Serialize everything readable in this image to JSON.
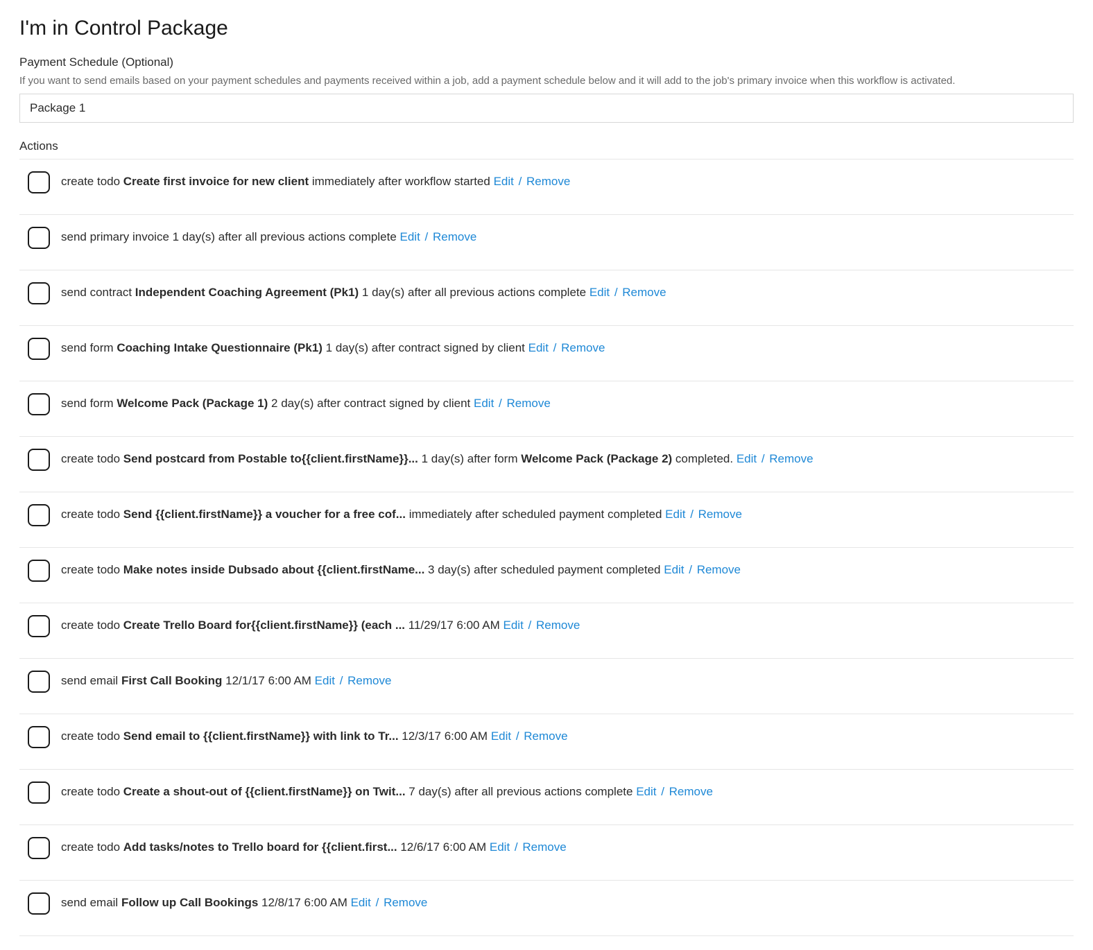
{
  "title": "I'm in Control Package",
  "payment_schedule": {
    "label": "Payment Schedule (Optional)",
    "help": "If you want to send emails based on your payment schedules and payments received within a job, add a payment schedule below and it will add to the job's primary invoice when this workflow is activated.",
    "selected": "Package 1"
  },
  "actions_label": "Actions",
  "edit_label": "Edit",
  "remove_label": "Remove",
  "actions": [
    {
      "prefix": "create todo ",
      "bold1": "Create first invoice for new client",
      "mid": " immediately after workflow started "
    },
    {
      "prefix": "send primary invoice 1 day(s) after all previous actions complete "
    },
    {
      "prefix": "send contract ",
      "bold1": "Independent Coaching Agreement (Pk1)",
      "mid": " 1 day(s) after all previous actions complete "
    },
    {
      "prefix": "send form ",
      "bold1": "Coaching Intake Questionnaire (Pk1)",
      "mid": " 1 day(s) after contract signed by client "
    },
    {
      "prefix": "send form ",
      "bold1": "Welcome Pack (Package 1)",
      "mid": " 2 day(s) after contract signed by client "
    },
    {
      "prefix": "create todo ",
      "bold1": "Send postcard from Postable to{{client.firstName}}...",
      "mid": " 1 day(s) after form ",
      "bold2": "Welcome Pack (Package 2)",
      "suffix": " completed. "
    },
    {
      "prefix": "create todo ",
      "bold1": "Send {{client.firstName}} a voucher for a free cof...",
      "mid": " immediately after scheduled payment completed "
    },
    {
      "prefix": "create todo ",
      "bold1": "Make notes inside Dubsado about {{client.firstName...",
      "mid": " 3 day(s) after scheduled payment completed "
    },
    {
      "prefix": "create todo ",
      "bold1": "Create Trello Board for{{client.firstName}} (each ...",
      "mid": " 11/29/17 6:00 AM "
    },
    {
      "prefix": "send email ",
      "bold1": "First Call Booking",
      "mid": " 12/1/17 6:00 AM "
    },
    {
      "prefix": "create todo ",
      "bold1": "Send email to {{client.firstName}} with link to Tr...",
      "mid": " 12/3/17 6:00 AM "
    },
    {
      "prefix": "create todo ",
      "bold1": "Create a shout-out of {{client.firstName}} on Twit...",
      "mid": " 7 day(s) after all previous actions complete "
    },
    {
      "prefix": "create todo ",
      "bold1": "Add tasks/notes to Trello board for {{client.first...",
      "mid": " 12/6/17 6:00 AM "
    },
    {
      "prefix": "send email ",
      "bold1": "Follow up Call Bookings",
      "mid": " 12/8/17 6:00 AM "
    }
  ]
}
